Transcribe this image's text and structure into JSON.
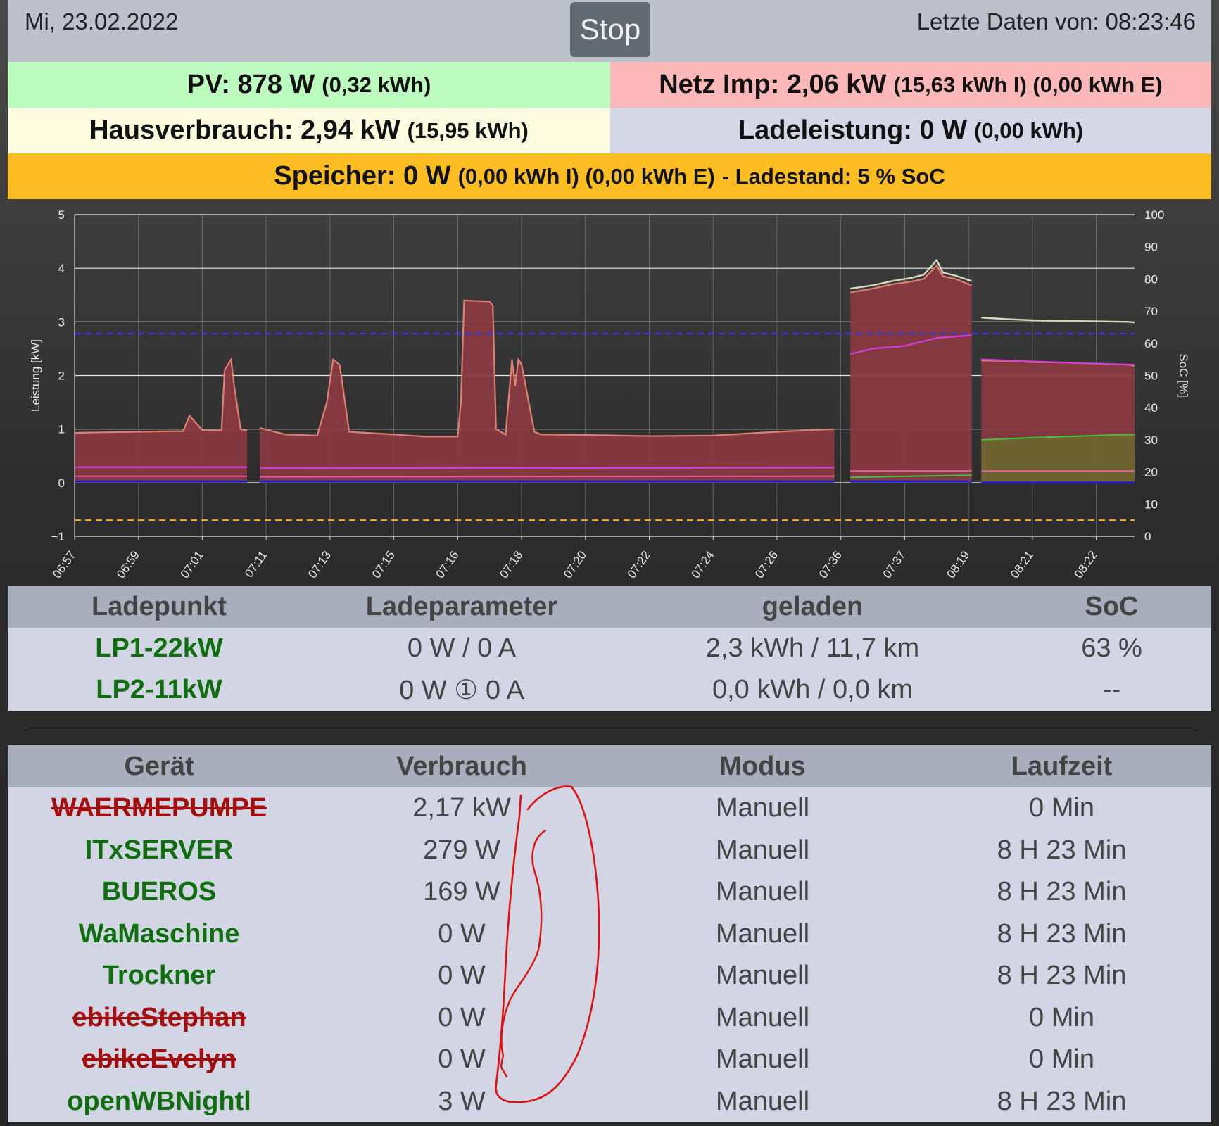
{
  "header": {
    "date": "Mi, 23.02.2022",
    "stop_label": "Stop",
    "last_update": "Letzte Daten von: 08:23:46"
  },
  "stats": {
    "pv_main": "PV: 878 W",
    "pv_sub": "(0,32 kWh)",
    "grid_main": "Netz Imp: 2,06 kW",
    "grid_sub": "(15,63 kWh I) (0,00 kWh E)",
    "house_main": "Hausverbrauch: 2,94 kW",
    "house_sub": "(15,95 kWh)",
    "charge_main": "Ladeleistung: 0 W",
    "charge_sub": "(0,00 kWh)",
    "storage_main": "Speicher: 0 W",
    "storage_sub": "(0,00 kWh I) (0,00 kWh E)",
    "storage_soc": "- Ladestand: 5 % SoC"
  },
  "chart_data": {
    "type": "area",
    "ylabel": "Leistung [kW]",
    "y2label": "SoC [%]",
    "ylim": [
      -1,
      5
    ],
    "y2lim": [
      0,
      100
    ],
    "yticks": [
      -1,
      0,
      1,
      2,
      3,
      4,
      5
    ],
    "y2ticks": [
      0,
      10,
      20,
      30,
      40,
      50,
      60,
      70,
      80,
      90,
      100
    ],
    "xticks": [
      "06:57",
      "06:59",
      "07:01",
      "07:11",
      "07:13",
      "07:15",
      "07:16",
      "07:18",
      "07:20",
      "07:22",
      "07:24",
      "07:26",
      "07:36",
      "07:37",
      "08:19",
      "08:21",
      "08:22"
    ],
    "xdomain": [
      0,
      16.6
    ],
    "grid": true,
    "colors": {
      "house": "#e08070",
      "house_fill": "#8b3a42",
      "white_line": "#d6d6c0",
      "magenta": "#d040d0",
      "pink": "#e060a0",
      "pv": "#3ec43e",
      "pv_fill": "#6b6a2c",
      "blue": "#2020c8",
      "dashed_blue": "#3838d8",
      "dashed_orange": "#ffa020"
    },
    "dashed_blue_value": 2.78,
    "dashed_orange_value": 5,
    "series": [
      {
        "segments": [
          {
            "x": [
              0,
              0.5,
              1.0,
              1.5,
              1.7,
              1.8,
              2.0,
              2.3,
              2.35,
              2.45,
              2.5,
              2.6,
              2.7
            ],
            "y": [
              0.93,
              0.94,
              0.95,
              0.96,
              0.96,
              1.25,
              0.98,
              0.97,
              2.1,
              2.3,
              1.8,
              1.0,
              0.97
            ]
          },
          {
            "x": [
              2.9,
              3.3,
              3.8,
              3.95,
              4.05,
              4.15,
              4.2,
              4.3,
              5.0,
              5.5,
              6.0,
              6.05,
              6.1,
              6.5,
              6.55,
              6.6,
              6.75,
              6.85,
              6.9,
              6.95,
              7.0,
              7.2,
              7.3,
              8.0,
              9.0,
              10.0,
              11.0,
              11.9
            ],
            "y": [
              1.02,
              0.9,
              0.88,
              1.5,
              2.3,
              2.2,
              1.8,
              0.95,
              0.9,
              0.86,
              0.86,
              1.5,
              3.4,
              3.38,
              3.3,
              1.0,
              0.9,
              2.3,
              1.8,
              2.3,
              2.2,
              0.95,
              0.9,
              0.89,
              0.87,
              0.88,
              0.95,
              1.0
            ]
          },
          {
            "x": [
              12.15,
              12.5,
              12.8,
              13.1,
              13.3,
              13.5,
              13.6,
              13.8,
              14.0,
              14.05
            ],
            "y": [
              3.55,
              3.62,
              3.7,
              3.75,
              3.8,
              4.05,
              3.85,
              3.8,
              3.7,
              3.68
            ]
          },
          {
            "x": [
              14.2,
              14.6,
              15.0,
              15.5,
              16.0,
              16.5,
              16.6
            ],
            "y": [
              2.28,
              2.27,
              2.25,
              2.24,
              2.22,
              2.2,
              2.18
            ]
          }
        ]
      },
      {
        "segments": [
          {
            "x": [
              12.15,
              12.5,
              12.8,
              13.1,
              13.3,
              13.5,
              13.6,
              13.8,
              14.0,
              14.05
            ],
            "y": [
              3.62,
              3.68,
              3.76,
              3.82,
              3.88,
              4.15,
              3.92,
              3.86,
              3.78,
              3.76
            ]
          },
          {
            "x": [
              14.2,
              14.6,
              15.0,
              15.5,
              16.0,
              16.5,
              16.6
            ],
            "y": [
              3.08,
              3.05,
              3.03,
              3.02,
              3.01,
              3.0,
              2.99
            ]
          }
        ]
      },
      {
        "segments": [
          {
            "x": [
              0,
              2.7
            ],
            "y": [
              0.29,
              0.29
            ]
          },
          {
            "x": [
              2.9,
              11.9
            ],
            "y": [
              0.27,
              0.28
            ]
          },
          {
            "x": [
              12.15,
              12.5,
              13.0,
              13.5,
              14.05
            ],
            "y": [
              2.4,
              2.5,
              2.55,
              2.7,
              2.75
            ]
          },
          {
            "x": [
              14.2,
              15.0,
              16.0,
              16.6
            ],
            "y": [
              2.3,
              2.26,
              2.22,
              2.2
            ]
          }
        ]
      },
      {
        "segments": [
          {
            "x": [
              0,
              2.7
            ],
            "y": [
              0.12,
              0.12
            ]
          },
          {
            "x": [
              2.9,
              11.9
            ],
            "y": [
              0.11,
              0.12
            ]
          },
          {
            "x": [
              12.15,
              14.05
            ],
            "y": [
              0.22,
              0.22
            ]
          },
          {
            "x": [
              14.2,
              16.6
            ],
            "y": [
              0.22,
              0.22
            ]
          }
        ]
      },
      {
        "segments": [
          {
            "x": [
              12.15,
              14.05
            ],
            "y": [
              0.1,
              0.14
            ]
          },
          {
            "x": [
              14.2,
              15.0,
              16.0,
              16.6
            ],
            "y": [
              0.8,
              0.84,
              0.88,
              0.9
            ]
          }
        ]
      },
      {
        "segments": [
          {
            "x": [
              0,
              2.7
            ],
            "y": [
              0.02,
              0.02
            ]
          },
          {
            "x": [
              2.9,
              11.9
            ],
            "y": [
              0.02,
              0.02
            ]
          },
          {
            "x": [
              12.15,
              14.05
            ],
            "y": [
              0.02,
              0.02
            ]
          },
          {
            "x": [
              14.2,
              16.6
            ],
            "y": [
              0.0,
              0.0
            ]
          }
        ]
      }
    ]
  },
  "lp_table": {
    "headers": [
      "Ladepunkt",
      "Ladeparameter",
      "geladen",
      "SoC"
    ],
    "rows": [
      {
        "name": "LP1-22kW",
        "params": "0 W / 0 A",
        "charged": "2,3 kWh / 11,7 km",
        "soc": "63 %"
      },
      {
        "name": "LP2-11kW",
        "params": "0 W ① 0 A",
        "charged": "0,0 kWh / 0,0 km",
        "soc": "--"
      }
    ]
  },
  "device_table": {
    "headers": [
      "Gerät",
      "Verbrauch",
      "Modus",
      "Laufzeit"
    ],
    "rows": [
      {
        "name": "WAERMEPUMPE",
        "usage": "2,17 kW",
        "mode": "Manuell",
        "runtime": "0 Min",
        "state": "off"
      },
      {
        "name": "ITxSERVER",
        "usage": "279 W",
        "mode": "Manuell",
        "runtime": "8 H 23 Min",
        "state": "on"
      },
      {
        "name": "BUEROS",
        "usage": "169 W",
        "mode": "Manuell",
        "runtime": "8 H 23 Min",
        "state": "on"
      },
      {
        "name": "WaMaschine",
        "usage": "0 W",
        "mode": "Manuell",
        "runtime": "8 H 23 Min",
        "state": "on"
      },
      {
        "name": "Trockner",
        "usage": "0 W",
        "mode": "Manuell",
        "runtime": "8 H 23 Min",
        "state": "on"
      },
      {
        "name": "ebikeStephan",
        "usage": "0 W",
        "mode": "Manuell",
        "runtime": "0 Min",
        "state": "off"
      },
      {
        "name": "ebikeEvelyn",
        "usage": "0 W",
        "mode": "Manuell",
        "runtime": "0 Min",
        "state": "off"
      },
      {
        "name": "openWBNightl",
        "usage": "3 W",
        "mode": "Manuell",
        "runtime": "8 H 23 Min",
        "state": "on"
      }
    ]
  }
}
